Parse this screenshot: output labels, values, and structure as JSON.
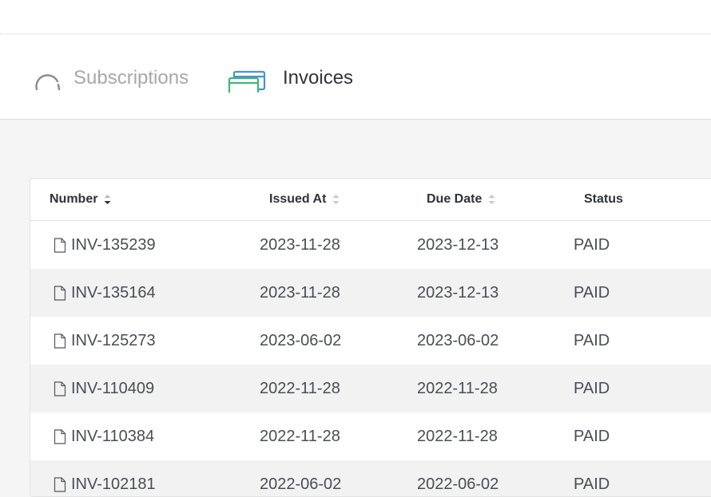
{
  "tabs": [
    {
      "label": "Subscriptions",
      "icon": "gauge-icon",
      "active": false
    },
    {
      "label": "Invoices",
      "icon": "cards-icon",
      "active": true
    }
  ],
  "table": {
    "columns": [
      {
        "label": "Number",
        "sort": "desc"
      },
      {
        "label": "Issued At",
        "sort": "none"
      },
      {
        "label": "Due Date",
        "sort": "none"
      },
      {
        "label": "Status",
        "sort": "unsortable"
      }
    ],
    "rows": [
      {
        "number": "INV-135239",
        "issued": "2023-11-28",
        "due": "2023-12-13",
        "status": "PAID"
      },
      {
        "number": "INV-135164",
        "issued": "2023-11-28",
        "due": "2023-12-13",
        "status": "PAID"
      },
      {
        "number": "INV-125273",
        "issued": "2023-06-02",
        "due": "2023-06-02",
        "status": "PAID"
      },
      {
        "number": "INV-110409",
        "issued": "2022-11-28",
        "due": "2022-11-28",
        "status": "PAID"
      },
      {
        "number": "INV-110384",
        "issued": "2022-11-28",
        "due": "2022-11-28",
        "status": "PAID"
      },
      {
        "number": "INV-102181",
        "issued": "2022-06-02",
        "due": "2022-06-02",
        "status": "PAID"
      }
    ]
  },
  "colors": {
    "active_tab_text": "#33333a",
    "inactive_tab_text": "#a8a8a8",
    "icon_blue": "#4a90d9",
    "icon_green": "#3cb878",
    "row_alt_bg": "#f2f2f2"
  }
}
